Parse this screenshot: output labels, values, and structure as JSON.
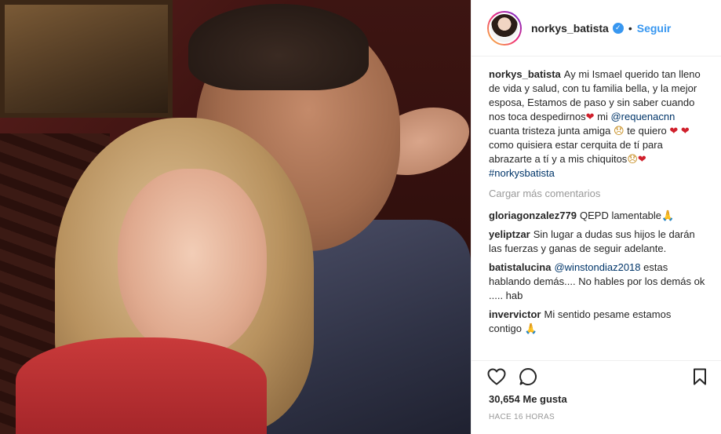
{
  "header": {
    "username": "norkys_batista",
    "separator": "•",
    "follow_label": "Seguir"
  },
  "caption": {
    "username": "norkys_batista",
    "text_1": "Ay mi Ismael querido tan lleno de vida y salud, con tu familia bella, y la mejor esposa, Estamos de paso y sin saber cuando nos toca despedirnos",
    "heart_1": "❤",
    "text_2": " mi ",
    "mention": "@requenacnn",
    "text_3": " cuanta tristeza junta amiga ",
    "sad_1": "😞",
    "text_4": " te quiero ",
    "hearts_2": "❤ ❤",
    "text_5": " como quisiera estar cerquita de tí para abrazarte a tí y a mis chiquitos",
    "sad_2": "😞",
    "heart_3": "❤",
    "hashtag": "#norkysbatista"
  },
  "load_more_label": "Cargar más comentarios",
  "comments": [
    {
      "username": "gloriagonzalez779",
      "text": "QEPD lamentable",
      "emoji": "🙏"
    },
    {
      "username": "yeliptzar",
      "text": "Sin lugar a dudas sus hijos le darán las fuerzas y ganas de seguir adelante."
    },
    {
      "username": "batistalucina",
      "mention": "@winstondiaz2018",
      "text": " estas hablando demás.... No hables por los demás ok ..... hab"
    },
    {
      "username": "invervictor",
      "text": "Mi sentido pesame estamos contigo ",
      "emoji": "🙏"
    }
  ],
  "likes": "30,654 Me gusta",
  "time_ago": "HACE 16 HORAS",
  "icons": {
    "like": "heart-outline-icon",
    "comment": "speech-bubble-icon",
    "save": "bookmark-icon",
    "verified": "verified-badge-icon"
  },
  "colors": {
    "accent": "#3897f0",
    "text": "#262626",
    "muted": "#999999",
    "link": "#003569"
  }
}
